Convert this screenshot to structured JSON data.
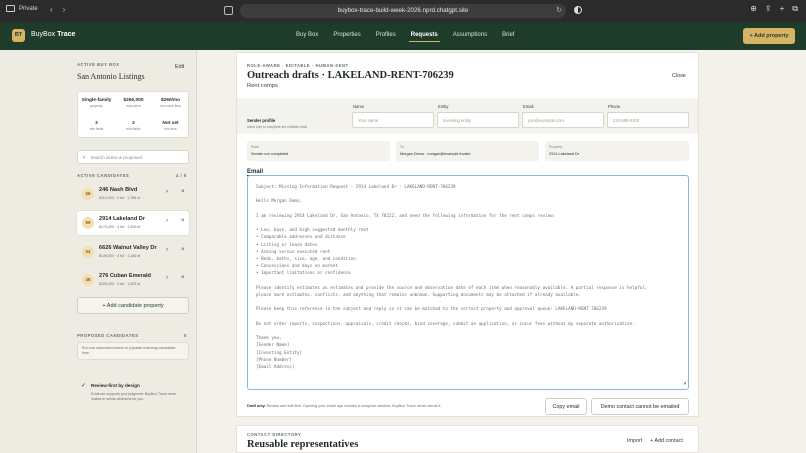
{
  "browser": {
    "private_label": "Private",
    "url": "buybox-trace-build-week-2026.nprd.chatgpt.site"
  },
  "app": {
    "logo_initials": "BT",
    "brand_a": "BuyBox",
    "brand_b": "Trace",
    "nav": [
      "Buy Box",
      "Properties",
      "Profiles",
      "Requests",
      "Assumptions",
      "Brief"
    ],
    "active_tab": "Requests",
    "add_property": "+ Add property"
  },
  "sidebar": {
    "active_label": "ACTIVE BUY BOX",
    "edit": "Edit",
    "title": "San Antonio Listings",
    "stats": [
      {
        "v": "Single-family",
        "k": "property"
      },
      {
        "v": "$260,000",
        "k": "max price"
      },
      {
        "v": "$260/mo",
        "k": "min cash flow"
      },
      {
        "v": "3",
        "k": "min beds"
      },
      {
        "v": "2",
        "k": "min baths"
      },
      {
        "v": "Not set",
        "k": "min size"
      }
    ],
    "search_placeholder": "Search active & proposed",
    "candidates_label": "ACTIVE CANDIDATES",
    "candidates_count": "4 / 5",
    "candidates": [
      {
        "score": "56",
        "name": "246 Nash Blvd",
        "meta": "$110,000 · 3 bd · 1,766 sf"
      },
      {
        "score": "59",
        "name": "2914 Lakeland Dr",
        "meta": "$175,000 · 4 bd · 1,500 sf"
      },
      {
        "score": "54",
        "name": "6626 Walnut Valley Dr",
        "meta": "$149,000 · 4 bd · 1,186 sf"
      },
      {
        "score": "48",
        "name": "276 Cuban Emerald",
        "meta": "$229,000 · 3 bd · 1,653 sf"
      }
    ],
    "add_candidate": "+ Add candidate property",
    "proposed_label": "PROPOSED CANDIDATES",
    "proposed_count": "0",
    "proposed_note": "Run one authorized search to populate matching candidates here.",
    "review_title": "Review-first by design",
    "review_desc": "Evidence supports your judgment. BuyBox Trace never makes or sends decisions for you."
  },
  "main": {
    "label": "ROLE-AWARE · EDITABLE · HUMAN-SENT",
    "title": "Outreach drafts · LAKELAND-RENT-706239",
    "subtitle": "Rent comps",
    "close": "Close",
    "sender_title": "Sender profile",
    "sender_desc": "Used only to complete the editable draft.",
    "fields": [
      {
        "label": "Name",
        "placeholder": "Your name"
      },
      {
        "label": "Entity",
        "placeholder": "Investing entity"
      },
      {
        "label": "Email",
        "placeholder": "you@example.com"
      },
      {
        "label": "Phone",
        "placeholder": "210-555-0100"
      }
    ],
    "from_k": "From",
    "from_v": "Sender not completed",
    "to_k": "To",
    "to_v": "Morgan Demo · morgan@example.invalid",
    "property_k": "Property",
    "property_v": "2914 Lakeland Dr",
    "email_label": "Email",
    "email_body": "Subject: Missing Information Request - 2914 Lakeland Dr - LAKELAND-RENT-706239\n\nHello Morgan Demo,\n\nI am reviewing 2914 Lakeland Dr, San Antonio, TX 78222, and need the following information for the rent comps review:\n\n• Low, base, and high suggested monthly rent\n• Comparable addresses and distance\n• Listing or lease dates\n• Asking versus executed rent\n• Beds, baths, size, age, and condition\n• Concessions and days on market\n• Important limitations or confidence\n\nPlease identify estimates as estimates and provide the source and observation date of each item when reasonably available. A partial response is helpful;\nplease mark estimates, conflicts, and anything that remains unknown. Supporting documents may be attached if already available.\n\nPlease keep this reference in the subject and reply so it can be matched to the correct property and approval queue: LAKELAND-RENT-706239\n\nDo not order reports, inspections, appraisals, credit checks, bind coverage, submit an application, or incur fees without my separate authorization.\n\nThank you,\n[Sender Name]\n[Investing Entity]\n[Phone Number]\n[Email Address]",
    "draft_note_bold": "Draft only.",
    "draft_note": " Review and edit first. Opening your email app creates a compose window; BuyBox Trace never sends it.",
    "copy_email": "Copy email",
    "demo_contact": "Demo contact cannot be emailed"
  },
  "directory": {
    "label": "CONTACT DIRECTORY",
    "title": "Reusable representatives",
    "import": "Import",
    "add_contact": "+ Add contact"
  }
}
